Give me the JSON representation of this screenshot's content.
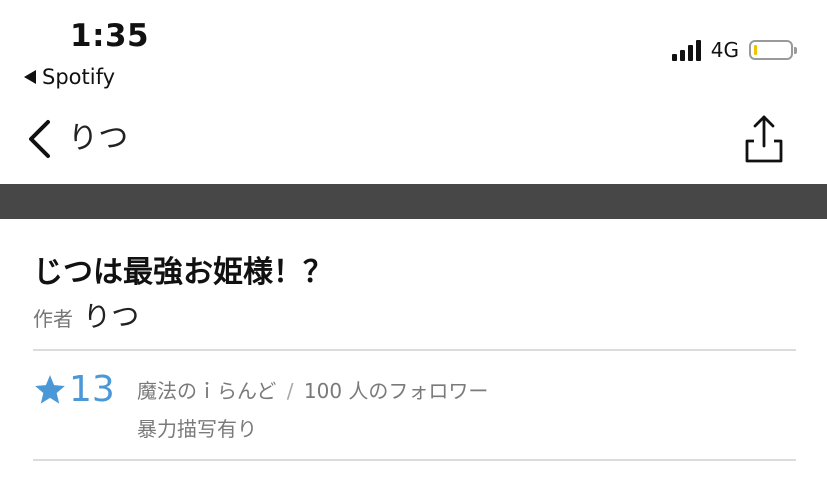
{
  "status_bar": {
    "time": "1:35",
    "back_app": "Spotify",
    "network": "4G",
    "battery_level_percent": 10,
    "battery_color": "#f2c300",
    "signal_bars": 4
  },
  "nav": {
    "title": "りつ",
    "back_icon": "chevron-left-icon",
    "share_icon": "share-icon"
  },
  "story": {
    "title": "じつは最強お姫様！？",
    "author_label": "作者",
    "author_name": "りつ",
    "star_count": "13",
    "community": "魔法のｉらんど",
    "separator": "/",
    "followers": "100 人のフォロワー",
    "warning": "暴力描写有り"
  },
  "colors": {
    "accent": "#4a98d8",
    "band": "#474747",
    "divider": "#dcdcdc",
    "muted_text": "#7a7a7a"
  }
}
